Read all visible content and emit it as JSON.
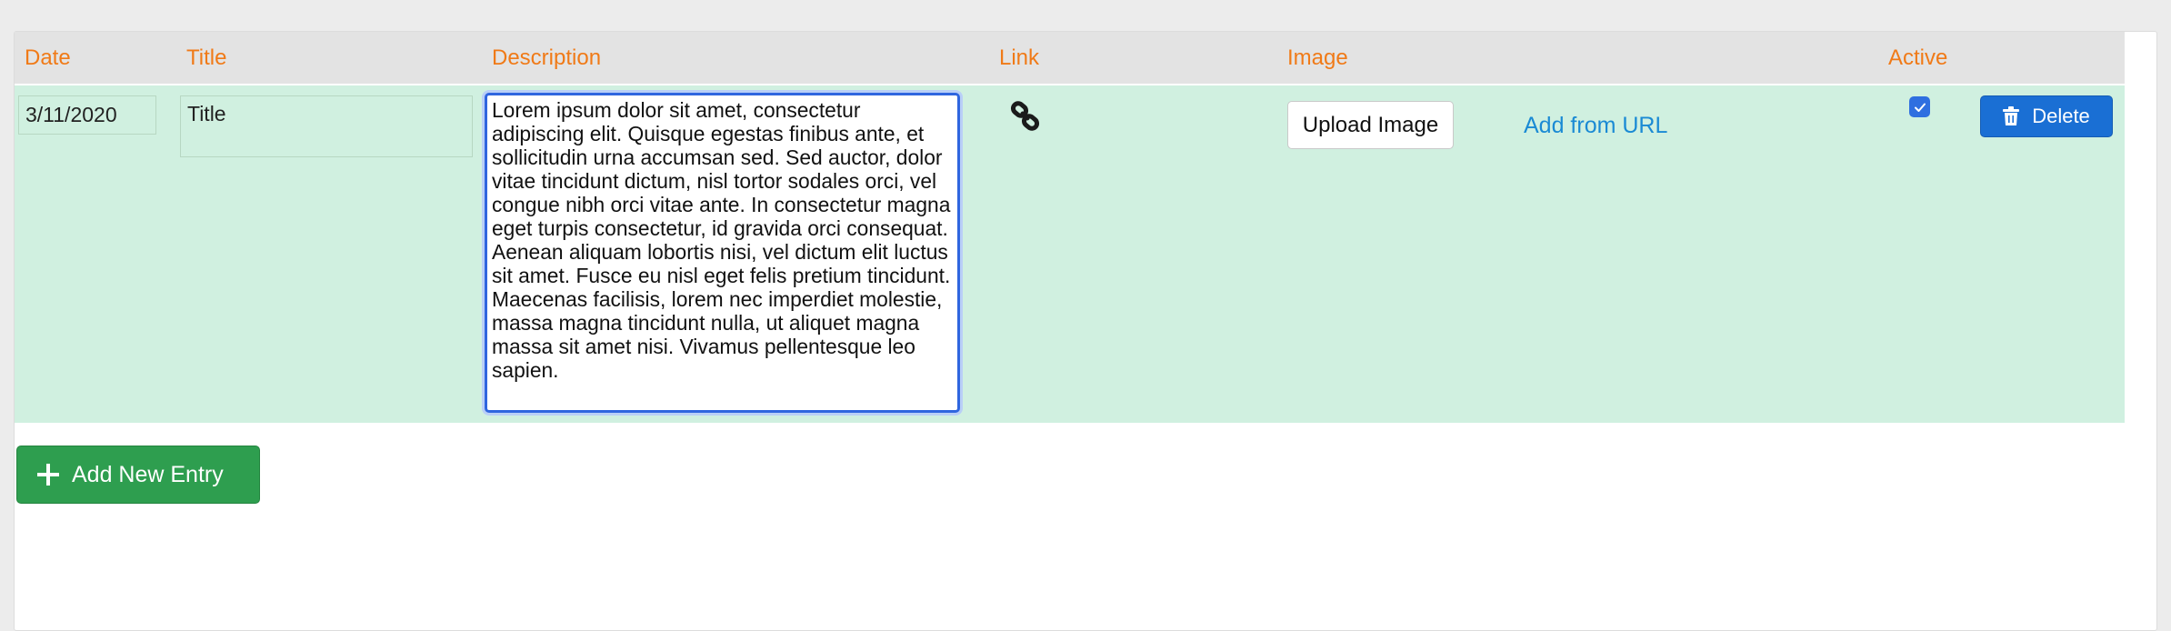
{
  "columns": {
    "date": "Date",
    "title": "Title",
    "description": "Description",
    "link": "Link",
    "image": "Image",
    "active": "Active"
  },
  "entry": {
    "date": "3/11/2020",
    "title": "Title",
    "description": "Lorem ipsum dolor sit amet, consectetur adipiscing elit. Quisque egestas finibus ante, et sollicitudin urna accumsan sed. Sed auctor, dolor vitae tincidunt dictum, nisl tortor sodales orci, vel congue nibh orci vitae ante. In consectetur magna eget turpis consectetur, id gravida orci consequat. Aenean aliquam lobortis nisi, vel dictum elit luctus sit amet. Fusce eu nisl eget felis pretium tincidunt. Maecenas facilisis, lorem nec imperdiet molestie, massa magna tincidunt nulla, ut aliquet magna massa sit amet nisi. Vivamus pellentesque leo sapien.",
    "link_icon": "link-icon",
    "upload_label": "Upload Image",
    "url_label": "Add from URL",
    "active": true,
    "delete_label": "Delete",
    "delete_icon": "trash-icon"
  },
  "footer": {
    "add_label": "Add New Entry",
    "add_icon": "plus-icon"
  },
  "colors": {
    "header_text": "#f07a17",
    "row_background": "#d0f0e0",
    "link_text": "#1a8ad4",
    "delete_button": "#1a6fd4",
    "add_button": "#2e9e4f"
  }
}
